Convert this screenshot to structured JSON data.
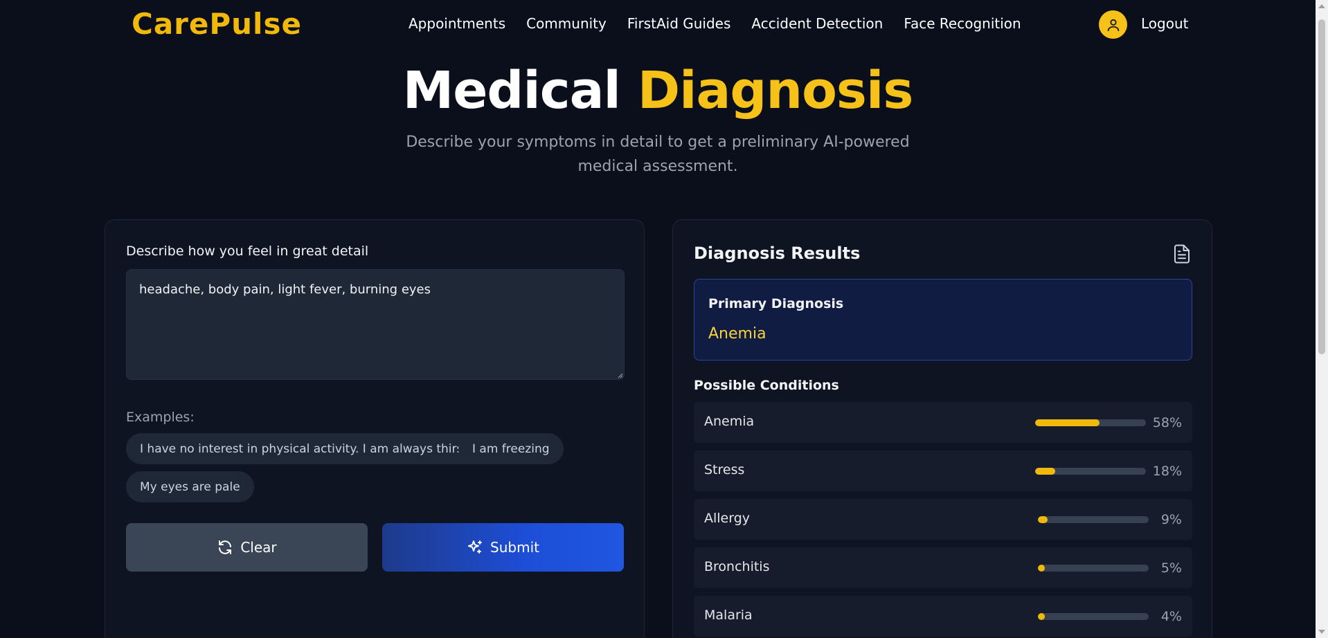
{
  "nav": {
    "logo": "CarePulse",
    "links": [
      "Appointments",
      "Community",
      "FirstAid Guides",
      "Accident Detection",
      "Face Recognition"
    ],
    "logout": "Logout",
    "avatar_icon": "user-icon"
  },
  "hero": {
    "title_part1": "Medical",
    "title_part2": "Diagnosis",
    "subtitle": "Describe your symptoms in detail to get a preliminary AI-powered medical assessment."
  },
  "form": {
    "label": "Describe how you feel in great detail",
    "symptoms_value": "headache, body pain, light fever, burning eyes",
    "examples_label": "Examples:",
    "examples": [
      "I have no interest in physical activity. I am always thirsty",
      "I am freezing",
      "My eyes are pale"
    ],
    "clear_label": "Clear",
    "submit_label": "Submit"
  },
  "results": {
    "title": "Diagnosis Results",
    "primary_label": "Primary Diagnosis",
    "primary_value": "Anemia",
    "conditions_label": "Possible Conditions",
    "conditions": [
      {
        "name": "Anemia",
        "percent": 58,
        "percent_label": "58%"
      },
      {
        "name": "Stress",
        "percent": 18,
        "percent_label": "18%"
      },
      {
        "name": "Allergy",
        "percent": 9,
        "percent_label": "9%"
      },
      {
        "name": "Bronchitis",
        "percent": 5,
        "percent_label": "5%"
      },
      {
        "name": "Malaria",
        "percent": 4,
        "percent_label": "4%"
      }
    ]
  },
  "colors": {
    "background": "#0b0f1c",
    "accent": "#f6c21a",
    "submit": "#1d4ed8",
    "clear": "#3a4556",
    "bar_fill": "#f2b90d",
    "bar_track": "#374151"
  }
}
